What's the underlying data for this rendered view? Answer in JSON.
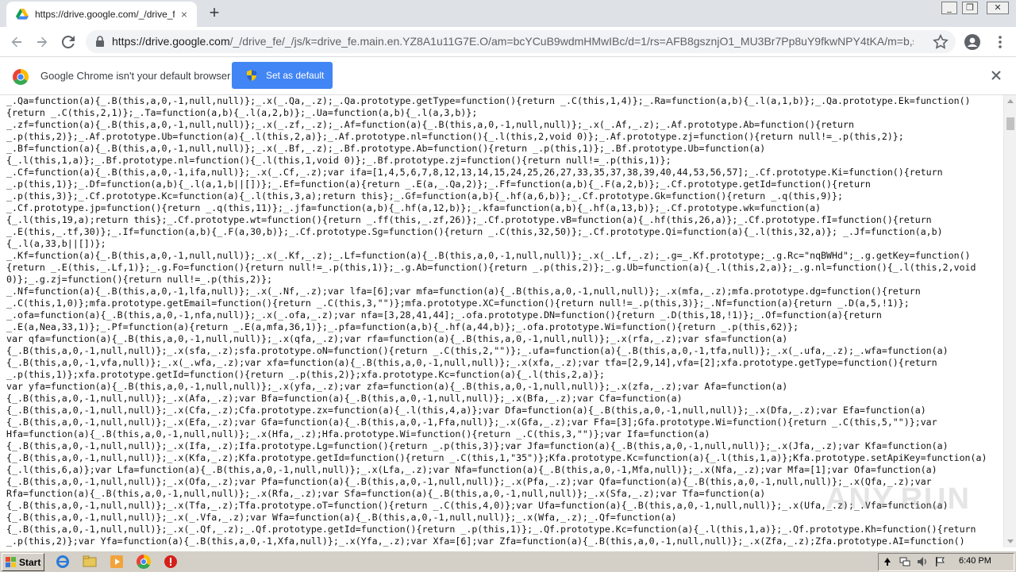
{
  "tab": {
    "title": "https://drive.google.com/_/drive_fe",
    "close": "×"
  },
  "new_tab": "+",
  "window_controls": {
    "minimize": "_",
    "restore": "❐",
    "close": "✕"
  },
  "address": {
    "host": "https://drive.google.com",
    "path": "/_/drive_fe/_/js/k=drive_fe.main.en.YZ8A1u11G7E.O/am=bcYCuB9wdmHMwIBc/d=1/rs=AFB8gsznjO1_MU3Br7Pp8uY9fkwNPY4tKA/m=b,s..."
  },
  "infobar": {
    "message": "Google Chrome isn't your default browser",
    "button_label": "Set as default"
  },
  "code_lines": [
    "_.Qa=function(a){_.B(this,a,0,-1,null,null)};_.x(_.Qa,_.z);_.Qa.prototype.getType=function(){return _.C(this,1,4)};_.Ra=function(a,b){_.l(a,1,b)};_.Qa.prototype.Ek=function()",
    "{return _.C(this,2,1)};_.Ta=function(a,b){_.l(a,2,b)};_.Ua=function(a,b){_.l(a,3,b)};",
    "_.zf=function(a){_.B(this,a,0,-1,null,null)};_.x(_.zf,_.z);_.Af=function(a){_.B(this,a,0,-1,null,null)};_.x(_.Af,_.z);_.Af.prototype.Ab=function(){return",
    "_.p(this,2)};_.Af.prototype.Ub=function(a){_.l(this,2,a)};_.Af.prototype.nl=function(){_.l(this,2,void 0)};_.Af.prototype.zj=function(){return null!=_.p(this,2)};",
    "_.Bf=function(a){_.B(this,a,0,-1,null,null)};_.x(_.Bf,_.z);_.Bf.prototype.Ab=function(){return _.p(this,1)};_.Bf.prototype.Ub=function(a)",
    "{_.l(this,1,a)};_.Bf.prototype.nl=function(){_.l(this,1,void 0)};_.Bf.prototype.zj=function(){return null!=_.p(this,1)};",
    "_.Cf=function(a){_.B(this,a,0,-1,ifa,null)};_.x(_.Cf,_.z);var ifa=[1,4,5,6,7,8,12,13,14,15,24,25,26,27,33,35,37,38,39,40,44,53,56,57];_.Cf.prototype.Ki=function(){return",
    "_.p(this,1)};_.Df=function(a,b){_.l(a,1,b||[])};_.Ef=function(a){return _.E(a,_.Qa,2)};_.Ff=function(a,b){_.F(a,2,b)};_.Cf.prototype.getId=function(){return",
    "_.p(this,3)};_.Cf.prototype.Kc=function(a){_.l(this,3,a);return this};_.Gf=function(a,b){_.hf(a,6,b)};_.Cf.prototype.Gk=function(){return _.q(this,9)};",
    "_.Cf.prototype.jp=function(){return _.q(this,11)};_.jfa=function(a,b){_.hf(a,12,b)};_.kfa=function(a,b){_.hf(a,13,b)};_.Cf.prototype.wk=function(a)",
    "{_.l(this,19,a);return this};_.Cf.prototype.wt=function(){return _.ff(this,_.zf,26)};_.Cf.prototype.vB=function(a){_.hf(this,26,a)};_.Cf.prototype.fI=function(){return",
    "_.E(this,_.tf,30)};_.If=function(a,b){_.F(a,30,b)};_.Cf.prototype.Sg=function(){return _.C(this,32,50)};_.Cf.prototype.Qi=function(a){_.l(this,32,a)}; _.Jf=function(a,b)",
    "{_.l(a,33,b||[])};",
    "_.Kf=function(a){_.B(this,a,0,-1,null,null)};_.x(_.Kf,_.z);_.Lf=function(a){_.B(this,a,0,-1,null,null)};_.x(_.Lf,_.z);_.g=_.Kf.prototype;_.g.Rc=\"nqBWHd\";_.g.getKey=function()",
    "{return _.E(this,_.Lf,1)};_.g.Fo=function(){return null!=_.p(this,1)};_.g.Ab=function(){return _.p(this,2)};_.g.Ub=function(a){_.l(this,2,a)};_.g.nl=function(){_.l(this,2,void",
    "0)};_.g.zj=function(){return null!=_.p(this,2)};",
    "_.Nf=function(a){_.B(this,a,0,-1,lfa,null)};_.x(_.Nf,_.z);var lfa=[6];var mfa=function(a){_.B(this,a,0,-1,null,null)};_.x(mfa,_.z);mfa.prototype.dg=function(){return",
    "_.C(this,1,0)};mfa.prototype.getEmail=function(){return _.C(this,3,\"\")};mfa.prototype.XC=function(){return null!=_.p(this,3)};_.Nf=function(a){return _.D(a,5,!1)};",
    "_.ofa=function(a){_.B(this,a,0,-1,nfa,null)};_.x(_.ofa,_.z);var nfa=[3,28,41,44];_.ofa.prototype.DN=function(){return _.D(this,18,!1)};_.Of=function(a){return",
    "_.E(a,Nea,33,1)};_.Pf=function(a){return _.E(a,mfa,36,1)};_.pfa=function(a,b){_.hf(a,44,b)};_.ofa.prototype.Wi=function(){return _.p(this,62)};",
    "var qfa=function(a){_.B(this,a,0,-1,null,null)};_.x(qfa,_.z);var rfa=function(a){_.B(this,a,0,-1,null,null)};_.x(rfa,_.z);var sfa=function(a)",
    "{_.B(this,a,0,-1,null,null)};_.x(sfa,_.z);sfa.prototype.oN=function(){return _.C(this,2,\"\")};_.ufa=function(a){_.B(this,a,0,-1,tfa,null)};_.x(_.ufa,_.z);_.wfa=function(a)",
    "{_.B(this,a,0,-1,vfa,null)};_.x(_.wfa,_.z);var xfa=function(a){_.B(this,a,0,-1,null,null)};_.x(xfa,_.z);var tfa=[2,9,14],vfa=[2];xfa.prototype.getType=function(){return",
    "_.p(this,1)};xfa.prototype.getId=function(){return _.p(this,2)};xfa.prototype.Kc=function(a){_.l(this,2,a)};",
    "var yfa=function(a){_.B(this,a,0,-1,null,null)};_.x(yfa,_.z);var zfa=function(a){_.B(this,a,0,-1,null,null)};_.x(zfa,_.z);var Afa=function(a)",
    "{_.B(this,a,0,-1,null,null)};_.x(Afa,_.z);var Bfa=function(a){_.B(this,a,0,-1,null,null)};_.x(Bfa,_.z);var Cfa=function(a)",
    "{_.B(this,a,0,-1,null,null)};_.x(Cfa,_.z);Cfa.prototype.zx=function(a){_.l(this,4,a)};var Dfa=function(a){_.B(this,a,0,-1,null,null)};_.x(Dfa,_.z);var Efa=function(a)",
    "{_.B(this,a,0,-1,null,null)};_.x(Efa,_.z);var Gfa=function(a){_.B(this,a,0,-1,Ffa,null)};_.x(Gfa,_.z);var Ffa=[3];Gfa.prototype.Wi=function(){return _.C(this,5,\"\")};var",
    "Hfa=function(a){_.B(this,a,0,-1,null,null)};_.x(Hfa,_.z);Hfa.prototype.Wi=function(){return _.C(this,3,\"\")};var Ifa=function(a)",
    "{_.B(this,a,0,-1,null,null)};_.x(Ifa,_.z);Ifa.prototype.Lg=function(){return _.p(this,3)};var Jfa=function(a){_.B(this,a,0,-1,null,null)};_.x(Jfa,_.z);var Kfa=function(a)",
    "{_.B(this,a,0,-1,null,null)};_.x(Kfa,_.z);Kfa.prototype.getId=function(){return _.C(this,1,\"35\")};Kfa.prototype.Kc=function(a){_.l(this,1,a)};Kfa.prototype.setApiKey=function(a)",
    "{_.l(this,6,a)};var Lfa=function(a){_.B(this,a,0,-1,null,null)};_.x(Lfa,_.z);var Nfa=function(a){_.B(this,a,0,-1,Mfa,null)};_.x(Nfa,_.z);var Mfa=[1];var Ofa=function(a)",
    "{_.B(this,a,0,-1,null,null)};_.x(Ofa,_.z);var Pfa=function(a){_.B(this,a,0,-1,null,null)};_.x(Pfa,_.z);var Qfa=function(a){_.B(this,a,0,-1,null,null)};_.x(Qfa,_.z);var",
    "Rfa=function(a){_.B(this,a,0,-1,null,null)};_.x(Rfa,_.z);var Sfa=function(a){_.B(this,a,0,-1,null,null)};_.x(Sfa,_.z);var Tfa=function(a)",
    "{_.B(this,a,0,-1,null,null)};_.x(Tfa,_.z);Tfa.prototype.oT=function(){return _.C(this,4,0)};var Ufa=function(a){_.B(this,a,0,-1,null,null)};_.x(Ufa,_.z);_.Vfa=function(a)",
    "{_.B(this,a,0,-1,null,null)};_.x(_.Vfa,_.z);var Wfa=function(a){_.B(this,a,0,-1,null,null)};_.x(Wfa,_.z);_.Qf=function(a)",
    "{_.B(this,a,0,-1,null,null)};_.x(_.Qf,_.z);_.Qf.prototype.getId=function(){return _.p(this,1)};_.Qf.prototype.Kc=function(a){_.l(this,1,a)};_.Qf.prototype.Kh=function(){return",
    "_.p(this,2)};var Yfa=function(a){_.B(this,a,0,-1,Xfa,null)};_.x(Yfa,_.z);var Xfa=[6];var Zfa=function(a){_.B(this,a,0,-1,null,null)};_.x(Zfa,_.z);Zfa.prototype.AI=function()"
  ],
  "watermark": "ANY.RUN",
  "taskbar": {
    "start_label": "Start",
    "clock": "6:40 PM"
  },
  "colors": {
    "accent": "#4285f4",
    "tabstrip": "#dee1e6",
    "taskbar": "#d4d0c8"
  }
}
